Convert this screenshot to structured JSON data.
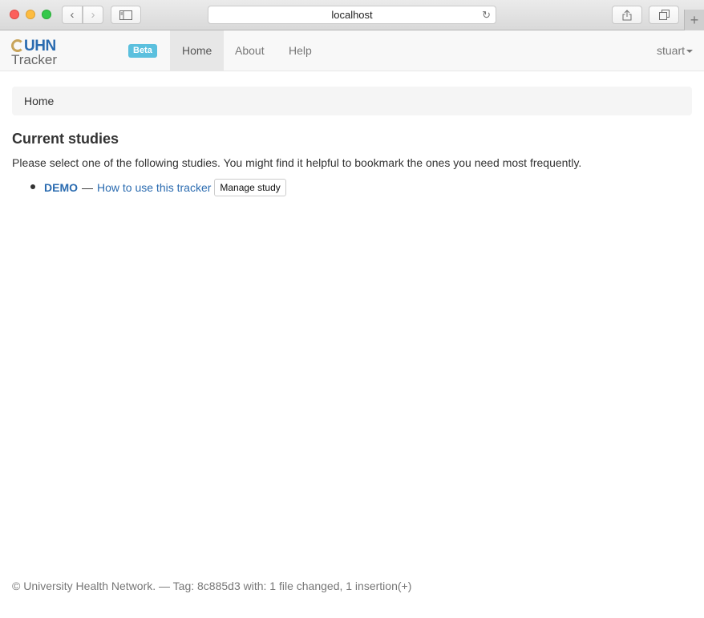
{
  "browser": {
    "address": "localhost"
  },
  "navbar": {
    "logo_top": "UHN",
    "logo_bottom": "Tracker",
    "badge": "Beta",
    "items": [
      {
        "label": "Home"
      },
      {
        "label": "About"
      },
      {
        "label": "Help"
      }
    ],
    "user": "stuart"
  },
  "breadcrumb": {
    "current": "Home"
  },
  "main": {
    "title": "Current studies",
    "intro": "Please select one of the following studies. You might find it helpful to bookmark the ones you need most frequently.",
    "studies": [
      {
        "name": "DEMO",
        "separator": "—",
        "help_link": "How to use this tracker",
        "manage_label": "Manage study"
      }
    ]
  },
  "footer": {
    "text": "© University Health Network. — Tag: 8c885d3 with: 1 file changed, 1 insertion(+)"
  },
  "colors": {
    "link": "#2a6bb0",
    "badge": "#5bc0de",
    "active_nav": "#e7e7e7"
  }
}
